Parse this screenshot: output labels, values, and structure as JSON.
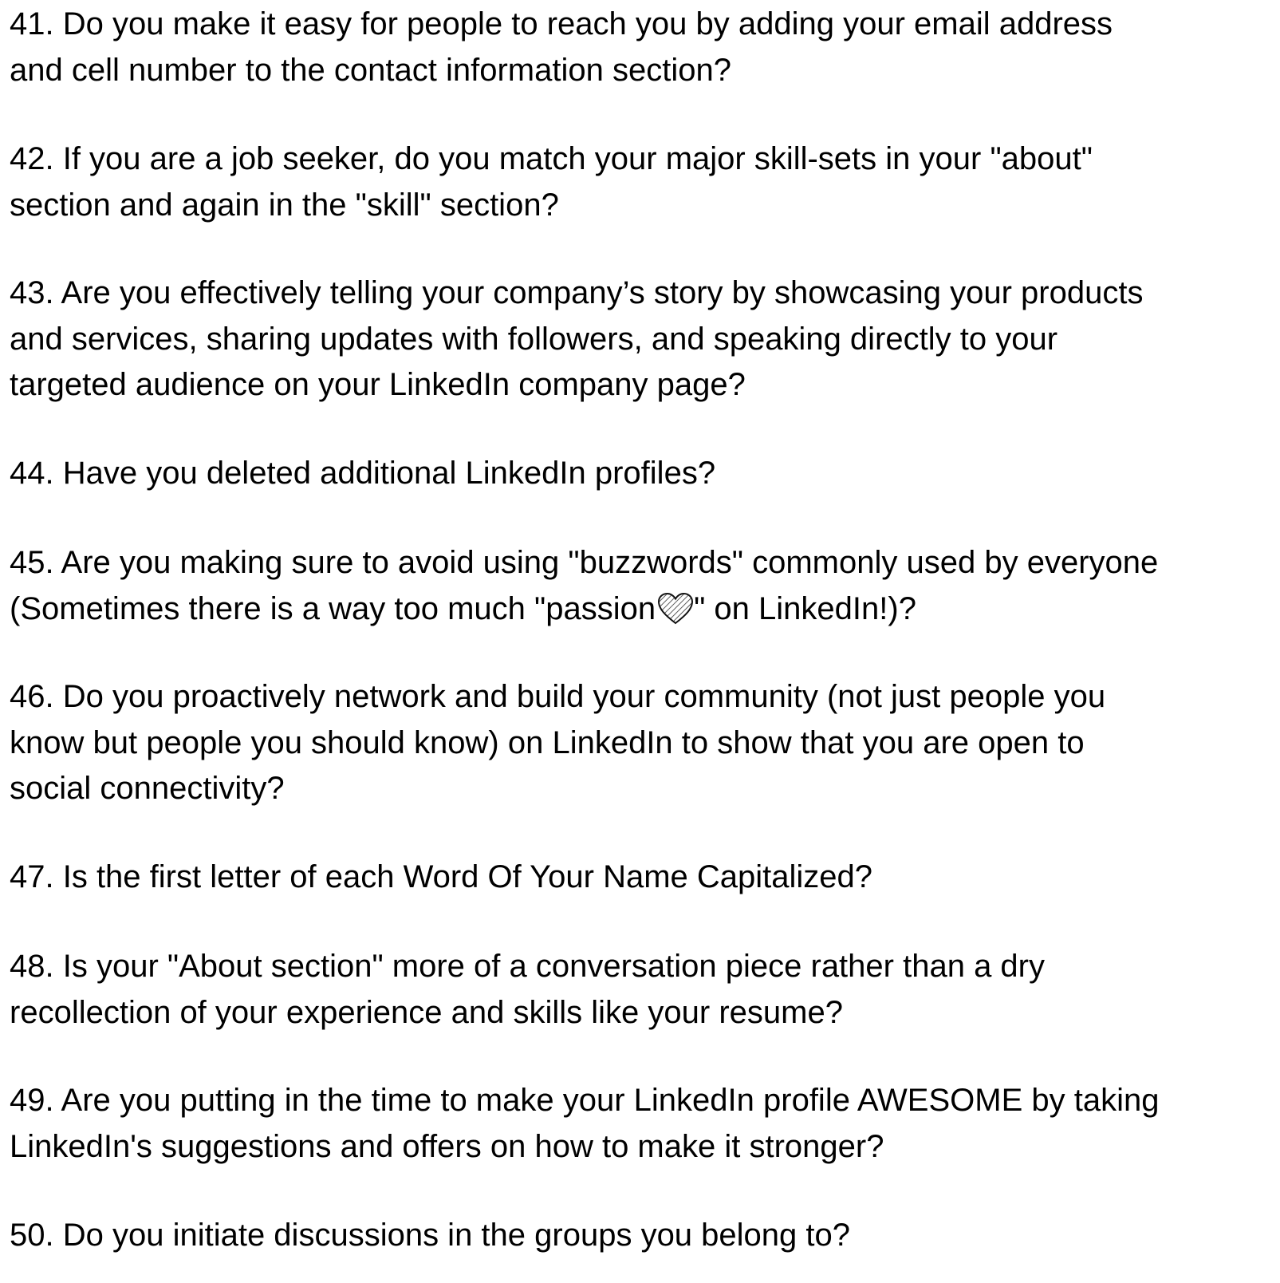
{
  "questions": [
    {
      "lines": [
        "41. Do you make it easy for people to reach you by adding your email address",
        "and cell number to the contact information section?"
      ]
    },
    {
      "lines": [
        "42. If you are a job seeker, do you match your major skill-sets in your \"about\"",
        "section and again in the \"skill\" section?"
      ]
    },
    {
      "lines": [
        "43. Are you effectively telling your company’s story by showcasing your products",
        "and services, sharing updates with followers, and speaking directly to your",
        "targeted audience on your LinkedIn company page?"
      ]
    },
    {
      "lines": [
        "44. Have you deleted additional LinkedIn profiles?"
      ]
    },
    {
      "lines": [
        "45. Are you making sure to avoid using \"buzzwords\" commonly used by everyone"
      ],
      "line2_before_icon": "(Sometimes there is a way too much \"passion",
      "line2_after_icon": "\" on LinkedIn!)?",
      "icon": "heart-icon"
    },
    {
      "lines": [
        "46. Do you proactively network and build your community (not just people you",
        "know but people you should know) on LinkedIn to show that you are open to",
        "social connectivity?"
      ]
    },
    {
      "lines": [
        "47. Is the first letter of each Word Of Your Name Capitalized?"
      ]
    },
    {
      "lines": [
        "48. Is your \"About section\" more of a conversation piece rather than a dry",
        "recollection of your experience and skills like your resume?"
      ]
    },
    {
      "lines": [
        "49. Are you putting in the time to make your LinkedIn profile AWESOME by taking",
        "LinkedIn's suggestions and offers on how to make it stronger?"
      ]
    },
    {
      "lines": [
        "50. Do you initiate discussions in the groups you belong to?"
      ]
    }
  ]
}
